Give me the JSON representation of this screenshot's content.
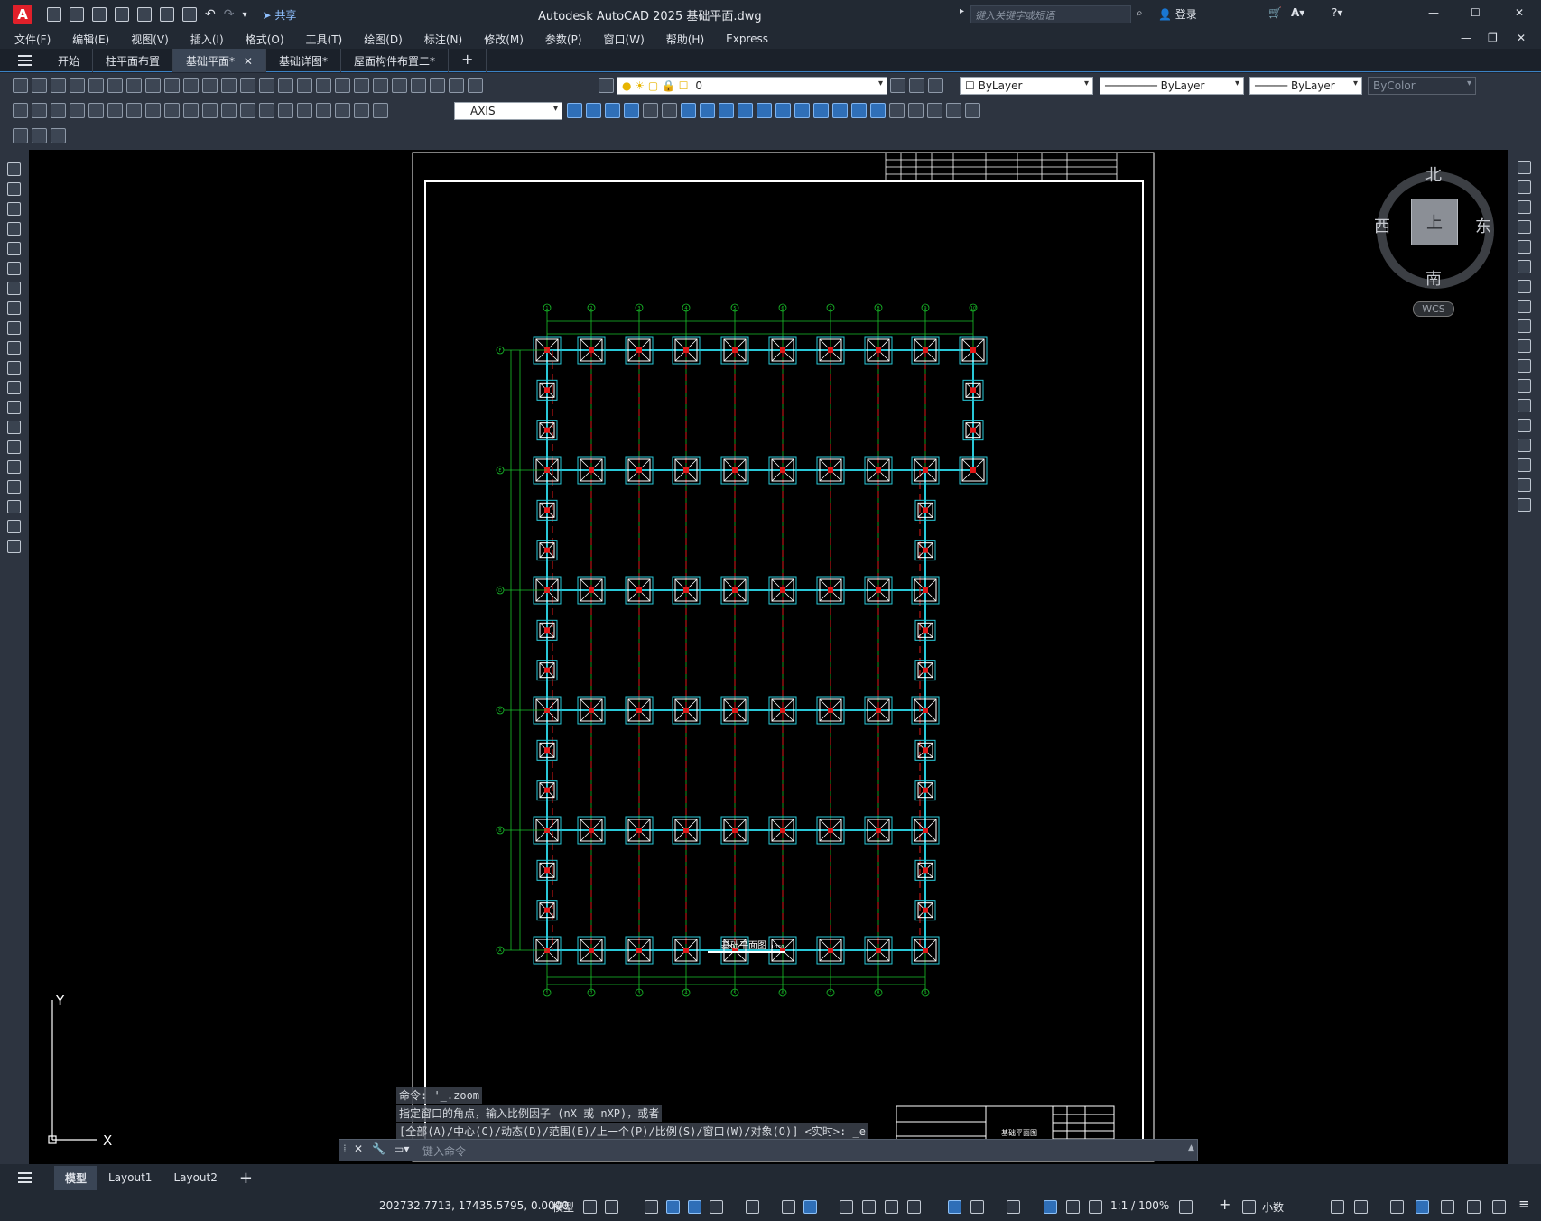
{
  "window": {
    "app_logo": "A",
    "title": "Autodesk AutoCAD 2025    基础平面.dwg",
    "share_label": "共享",
    "search_placeholder": "键入关键字或短语",
    "login_label": "登录"
  },
  "menu": [
    "文件(F)",
    "编辑(E)",
    "视图(V)",
    "插入(I)",
    "格式(O)",
    "工具(T)",
    "绘图(D)",
    "标注(N)",
    "修改(M)",
    "参数(P)",
    "窗口(W)",
    "帮助(H)",
    "Express"
  ],
  "doc_tabs": [
    {
      "label": "开始",
      "active": false
    },
    {
      "label": "柱平面布置",
      "active": false
    },
    {
      "label": "基础平面*",
      "active": true
    },
    {
      "label": "基础详图*",
      "active": false
    },
    {
      "label": "屋面构件布置二*",
      "active": false
    }
  ],
  "toolbar": {
    "layer_value": "0",
    "color_value": "ByLayer",
    "linetype_value": "ByLayer",
    "lineweight_value": "ByLayer",
    "plotstyle_value": "ByColor",
    "dimstyle_value": "AXIS"
  },
  "viewcube": {
    "north": "北",
    "south": "南",
    "east": "东",
    "west": "西",
    "face": "上",
    "wcs_label": "WCS"
  },
  "ucs": {
    "x_label": "X",
    "y_label": "Y"
  },
  "drawing": {
    "plan_title": "基础平面图",
    "plan_scale": "1:150",
    "titleblock_name": "基础平面图",
    "grid_top": [
      "1",
      "2",
      "3",
      "4",
      "5",
      "6",
      "7",
      "8",
      "9",
      "10"
    ],
    "grid_left": [
      "F",
      "E",
      "D",
      "C",
      "B",
      "A"
    ],
    "grid_bottom": [
      "1",
      "2",
      "3",
      "4",
      "5",
      "6",
      "7",
      "8",
      "9"
    ]
  },
  "command_line": {
    "history": [
      "命令: '_.zoom",
      "指定窗口的角点，输入比例因子 (nX 或 nXP)，或者",
      "[全部(A)/中心(C)/动态(D)/范围(E)/上一个(P)/比例(S)/窗口(W)/对象(O)] <实时>: _e"
    ],
    "placeholder": "键入命令"
  },
  "layout_tabs": [
    {
      "label": "模型",
      "active": true
    },
    {
      "label": "Layout1",
      "active": false
    },
    {
      "label": "Layout2",
      "active": false
    }
  ],
  "status": {
    "coordinates": "202732.7713, 17435.5795, 0.0000",
    "model_label": "模型",
    "scale_label": "1:1 / 100%",
    "units_label": "小数"
  }
}
